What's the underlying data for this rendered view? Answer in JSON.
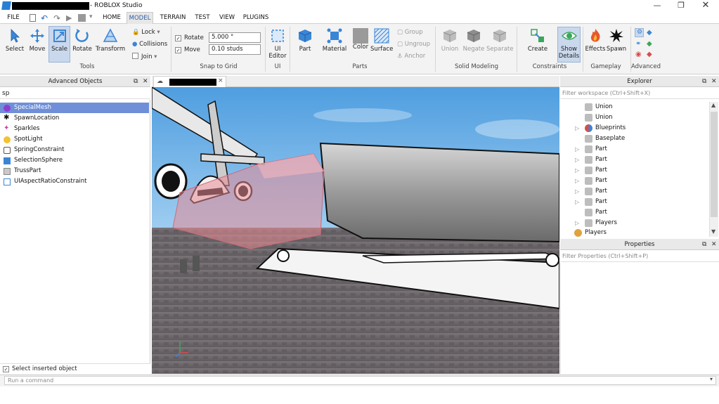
{
  "app": {
    "title": "- ROBLOX Studio"
  },
  "menu": [
    "FILE",
    "HOME",
    "MODEL",
    "TERRAIN",
    "TEST",
    "VIEW",
    "PLUGINS"
  ],
  "ribbon": {
    "tools": [
      "Select",
      "Move",
      "Scale",
      "Rotate",
      "Transform"
    ],
    "tools_group": "Tools",
    "lock": "Lock",
    "collisions": "Collisions",
    "join": "Join",
    "rotate_label": "Rotate",
    "rotate_value": "5.000 °",
    "move_label": "Move",
    "move_value": "0.10 studs",
    "snap_group": "Snap to Grid",
    "ui_editor": "UI Editor",
    "ui_group": "UI",
    "part": "Part",
    "material": "Material",
    "color": "Color",
    "surface": "Surface",
    "group": "Group",
    "ungroup": "Ungroup",
    "anchor": "Anchor",
    "parts_group": "Parts",
    "union": "Union",
    "negate": "Negate",
    "separate": "Separate",
    "solid_group": "Solid Modeling",
    "create": "Create",
    "show_details": "Show Details",
    "constraints_group": "Constraints",
    "effects": "Effects",
    "spawn": "Spawn",
    "gameplay_group": "Gameplay",
    "advanced_group": "Advanced"
  },
  "advanced_objects": {
    "title": "Advanced Objects",
    "search": "sp",
    "items": [
      "SpecialMesh",
      "SpawnLocation",
      "Sparkles",
      "SpotLight",
      "SpringConstraint",
      "SelectionSphere",
      "TrussPart",
      "UIAspectRatioConstraint"
    ],
    "select_inserted": "Select inserted object"
  },
  "viewport": {
    "tab_close": "×"
  },
  "explorer": {
    "title": "Explorer",
    "filter_placeholder": "Filter workspace (Ctrl+Shift+X)",
    "items": [
      "Union",
      "Union",
      "Blueprints",
      "Baseplate",
      "Part",
      "Part",
      "Part",
      "Part",
      "Part",
      "Part",
      "Part",
      "Players"
    ]
  },
  "properties": {
    "title": "Properties",
    "filter_placeholder": "Filter Properties (Ctrl+Shift+P)"
  },
  "command": {
    "placeholder": "Run a command"
  },
  "colors": {
    "accent": "#2b7bd6",
    "selected": "#6f8fd8"
  }
}
